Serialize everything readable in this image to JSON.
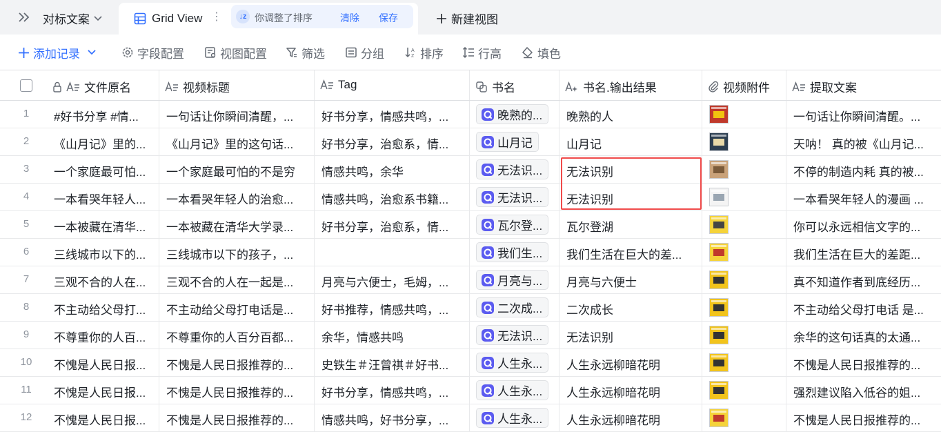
{
  "tabbar": {
    "title": "对标文案",
    "active_tab": "Grid View",
    "sort_notice": "你调整了排序",
    "clear_label": "清除",
    "save_label": "保存",
    "new_view_label": "新建视图"
  },
  "toolbar": {
    "add_record": "添加记录",
    "field_config": "字段配置",
    "view_config": "视图配置",
    "filter": "筛选",
    "group": "分组",
    "sort": "排序",
    "row_height": "行高",
    "fill_color": "填色"
  },
  "columns": {
    "file_name": "文件原名",
    "video_title": "视频标题",
    "tag": "Tag",
    "book_name": "书名",
    "book_output": "书名.输出结果",
    "video_attachment": "视频附件",
    "extracted_copy": "提取文案"
  },
  "colors": {
    "accent": "#3370ff",
    "highlight_border": "#f04a4a"
  },
  "rows": [
    {
      "num": "1",
      "file": "#好书分享 #情...",
      "title": "一句话让你瞬间清醒，...",
      "tag": "好书分享，情感共鸣，...",
      "book": "晚熟的...",
      "output": "晚熟的人",
      "thumb": "red",
      "copy": "一句话让你瞬间清醒。..."
    },
    {
      "num": "2",
      "file": "《山月记》里的...",
      "title": "《山月记》里的这句话...",
      "tag": "好书分享，治愈系，情...",
      "book": "山月记",
      "output": "山月记",
      "thumb": "blue",
      "copy": "天呐！ 真的被《山月记..."
    },
    {
      "num": "3",
      "file": "一个家庭最可怕...",
      "title": "一个家庭最可怕的不是穷",
      "tag": "情感共鸣，余华",
      "book": "无法识...",
      "output": "无法识别",
      "thumb": "tan",
      "copy": "不停的制造内耗 真的被..."
    },
    {
      "num": "4",
      "file": "一本看哭年轻人...",
      "title": "一本看哭年轻人的治愈...",
      "tag": "情感共鸣，治愈系书籍...",
      "book": "无法识...",
      "output": "无法识别",
      "thumb": "white",
      "copy": "一本看哭年轻人的漫画 ..."
    },
    {
      "num": "5",
      "file": "一本被藏在清华...",
      "title": "一本被藏在清华大学录...",
      "tag": "好书分享，治愈系，情...",
      "book": "瓦尔登...",
      "output": "瓦尔登湖",
      "thumb": "yellow",
      "copy": "你可以永远相信文字的..."
    },
    {
      "num": "6",
      "file": "三线城市以下的...",
      "title": "三线城市以下的孩子，...",
      "tag": "",
      "book": "我们生...",
      "output": "我们生活在巨大的差...",
      "thumb": "yellow-red",
      "copy": "我们生活在巨大的差距..."
    },
    {
      "num": "7",
      "file": "三观不合的人在...",
      "title": "三观不合的人在一起是...",
      "tag": "月亮与六便士，毛姆，...",
      "book": "月亮与...",
      "output": "月亮与六便士",
      "thumb": "yellow-dark",
      "copy": "真不知道作者到底经历..."
    },
    {
      "num": "8",
      "file": "不主动给父母打...",
      "title": "不主动给父母打电话是...",
      "tag": "好书推荐，情感共鸣，...",
      "book": "二次成...",
      "output": "二次成长",
      "thumb": "yellow-dark",
      "copy": "不主动给父母打电话 是..."
    },
    {
      "num": "9",
      "file": "不尊重你的人百...",
      "title": "不尊重你的人百分百都...",
      "tag": "余华，情感共鸣",
      "book": "无法识...",
      "output": "无法识别",
      "thumb": "yellow-dark",
      "copy": "余华的这句话真的太通..."
    },
    {
      "num": "10",
      "file": "不愧是人民日报...",
      "title": "不愧是人民日报推荐的...",
      "tag": "史铁生＃汪曾祺＃好书...",
      "book": "人生永...",
      "output": "人生永远柳暗花明",
      "thumb": "yellow-dark",
      "copy": "不愧是人民日报推荐的..."
    },
    {
      "num": "11",
      "file": "不愧是人民日报...",
      "title": "不愧是人民日报推荐的...",
      "tag": "好书分享，情感共鸣，...",
      "book": "人生永...",
      "output": "人生永远柳暗花明",
      "thumb": "yellow-dark",
      "copy": "强烈建议陷入低谷的姐..."
    },
    {
      "num": "12",
      "file": "不愧是人民日报...",
      "title": "不愧是人民日报推荐的...",
      "tag": "情感共鸣，好书分享，...",
      "book": "人生永...",
      "output": "人生永远柳暗花明",
      "thumb": "yellow-red",
      "copy": "不愧是人民日报推荐的..."
    }
  ]
}
